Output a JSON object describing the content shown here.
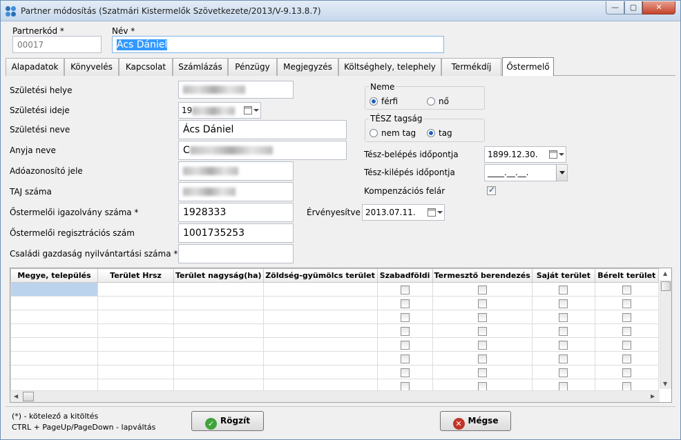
{
  "window": {
    "title": "Partner módosítás (Szatmári Kistermelők Szövetkezete/2013/V-9.13.8.7)",
    "min_glyph": "—",
    "max_glyph": "▢",
    "close_glyph": "✕"
  },
  "header": {
    "partnerkod_label": "Partnerkód *",
    "partnerkod_value": "00017",
    "nev_label": "Név *",
    "nev_value": "Ács Dániel"
  },
  "tabs": [
    {
      "label": "Alapadatok"
    },
    {
      "label": "Könyvelés"
    },
    {
      "label": "Kapcsolat"
    },
    {
      "label": "Számlázás"
    },
    {
      "label": "Pénzügy"
    },
    {
      "label": "Megjegyzés"
    },
    {
      "label": "Költséghely, telephely"
    },
    {
      "label": "Termékdíj"
    },
    {
      "label": "Őstermelő"
    }
  ],
  "active_tab": "Őstermelő",
  "form": {
    "szuletesi_helye_label": "Születési helye",
    "szuletesi_ideje_label": "Születési ideje",
    "szuletesi_ideje_value": "19",
    "szuletesi_neve_label": "Születési neve",
    "szuletesi_neve_value": "Ács Dániel",
    "anyja_neve_label": "Anyja neve",
    "anyja_neve_value": "C",
    "adoazonosito_label": "Adóazonosító jele",
    "taj_label": "TAJ száma",
    "igazolvany_label": "Őstermelői igazolvány száma *",
    "igazolvany_value": "1928333",
    "regisztracios_label": "Őstermelői regisztrációs szám",
    "regisztracios_value": "1001735253",
    "csaladi_label": "Családi gazdaság nyilvántartási száma *",
    "csaladi_value": ""
  },
  "neme": {
    "title": "Neme",
    "options": [
      {
        "label": "férfi",
        "selected": true
      },
      {
        "label": "nő",
        "selected": false
      }
    ]
  },
  "tesz": {
    "title": "TÉSZ tagság",
    "options": [
      {
        "label": "nem tag",
        "selected": false
      },
      {
        "label": "tag",
        "selected": true
      }
    ],
    "belepes_label": "Tész-belépés időpontja",
    "belepes_value": "1899.12.30.",
    "kilepes_label": "Tész-kilépés időpontja",
    "kilepes_value": "____.__.__.",
    "kompenzacios_label": "Kompenzációs felár",
    "kompenzacios_checked": true,
    "ervenyesitve_label": "Érvényesítve",
    "ervenyesitve_value": "2013.07.11."
  },
  "grid": {
    "columns": [
      {
        "label": "Megye, település"
      },
      {
        "label": "Terület Hrsz"
      },
      {
        "label": "Terület nagyság(ha)"
      },
      {
        "label": "Zöldség-gyümölcs terület"
      },
      {
        "label": "Szabadföldi"
      },
      {
        "label": "Termesztő berendezés"
      },
      {
        "label": "Saját terület"
      },
      {
        "label": "Bérelt terület"
      }
    ],
    "rows": [
      [
        "",
        "",
        "",
        "",
        false,
        false,
        false,
        false
      ],
      [
        "",
        "",
        "",
        "",
        false,
        false,
        false,
        false
      ],
      [
        "",
        "",
        "",
        "",
        false,
        false,
        false,
        false
      ],
      [
        "",
        "",
        "",
        "",
        false,
        false,
        false,
        false
      ],
      [
        "",
        "",
        "",
        "",
        false,
        false,
        false,
        false
      ],
      [
        "",
        "",
        "",
        "",
        false,
        false,
        false,
        false
      ],
      [
        "",
        "",
        "",
        "",
        false,
        false,
        false,
        false
      ],
      [
        "",
        "",
        "",
        "",
        false,
        false,
        false,
        false
      ]
    ]
  },
  "footer": {
    "note1": "(*) - kötelező a kitöltés",
    "note2": "CTRL + PageUp/PageDown - lapváltás",
    "save_label": "Rögzít",
    "cancel_label": "Mégse"
  },
  "colors": {
    "selection": "#bcd3ee",
    "accent": "#1e5fbf"
  }
}
